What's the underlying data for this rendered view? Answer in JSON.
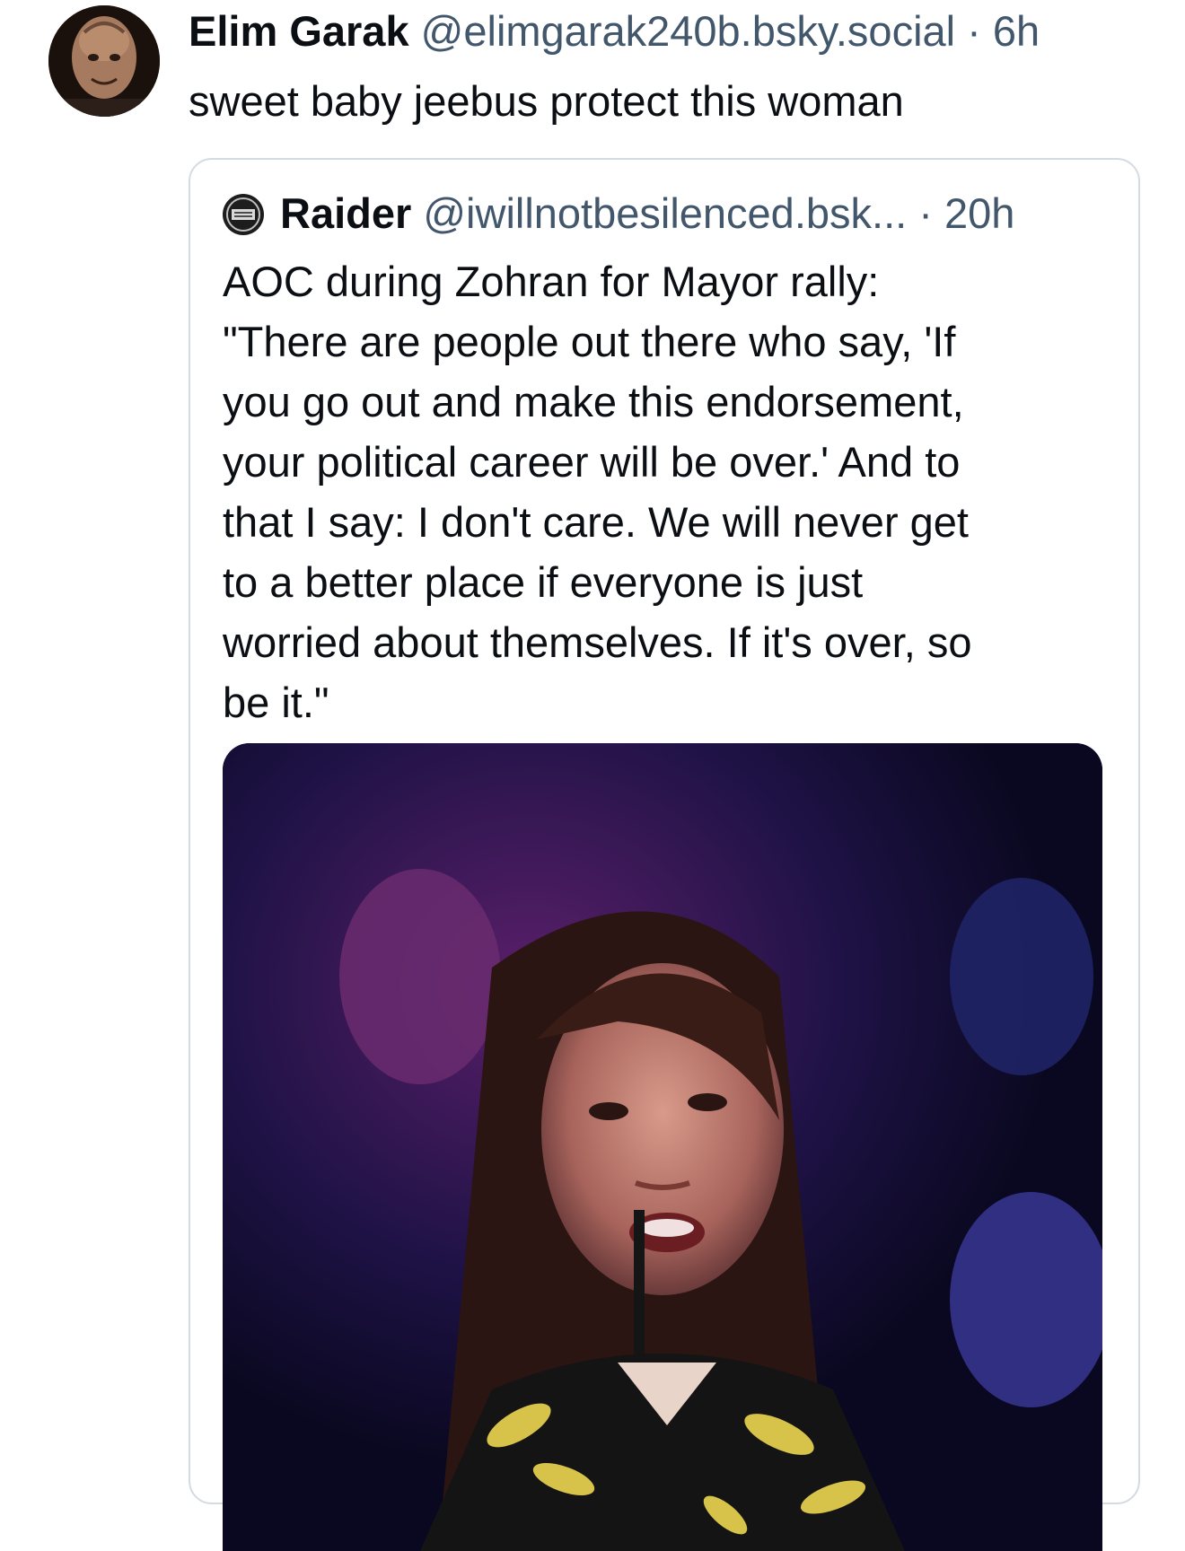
{
  "post": {
    "display_name": "Elim Garak",
    "handle": "@elimgarak240b.bsky.social",
    "separator": "·",
    "time": "6h",
    "text": "sweet baby jeebus protect this woman",
    "avatar": "avatar-photo"
  },
  "quoted_post": {
    "display_name": "Raider",
    "handle": "@iwillnotbesilenced.bsk...",
    "separator": "·",
    "time": "20h",
    "avatar": "raider-logo-icon",
    "text": "AOC during Zohran for Mayor rally:\n\"There are people out there who say, 'If\nyou go out and make this endorsement,\nyour political career will be over.' And to\nthat I say: I don't care. We will never get\nto a better place if everyone is just\nworried about themselves. If it's over, so\nbe it.\"",
    "media": "video-still"
  },
  "colors": {
    "text_primary": "#0b0f14",
    "text_secondary": "#42576c",
    "border": "#d4dbe2",
    "background": "#ffffff"
  }
}
